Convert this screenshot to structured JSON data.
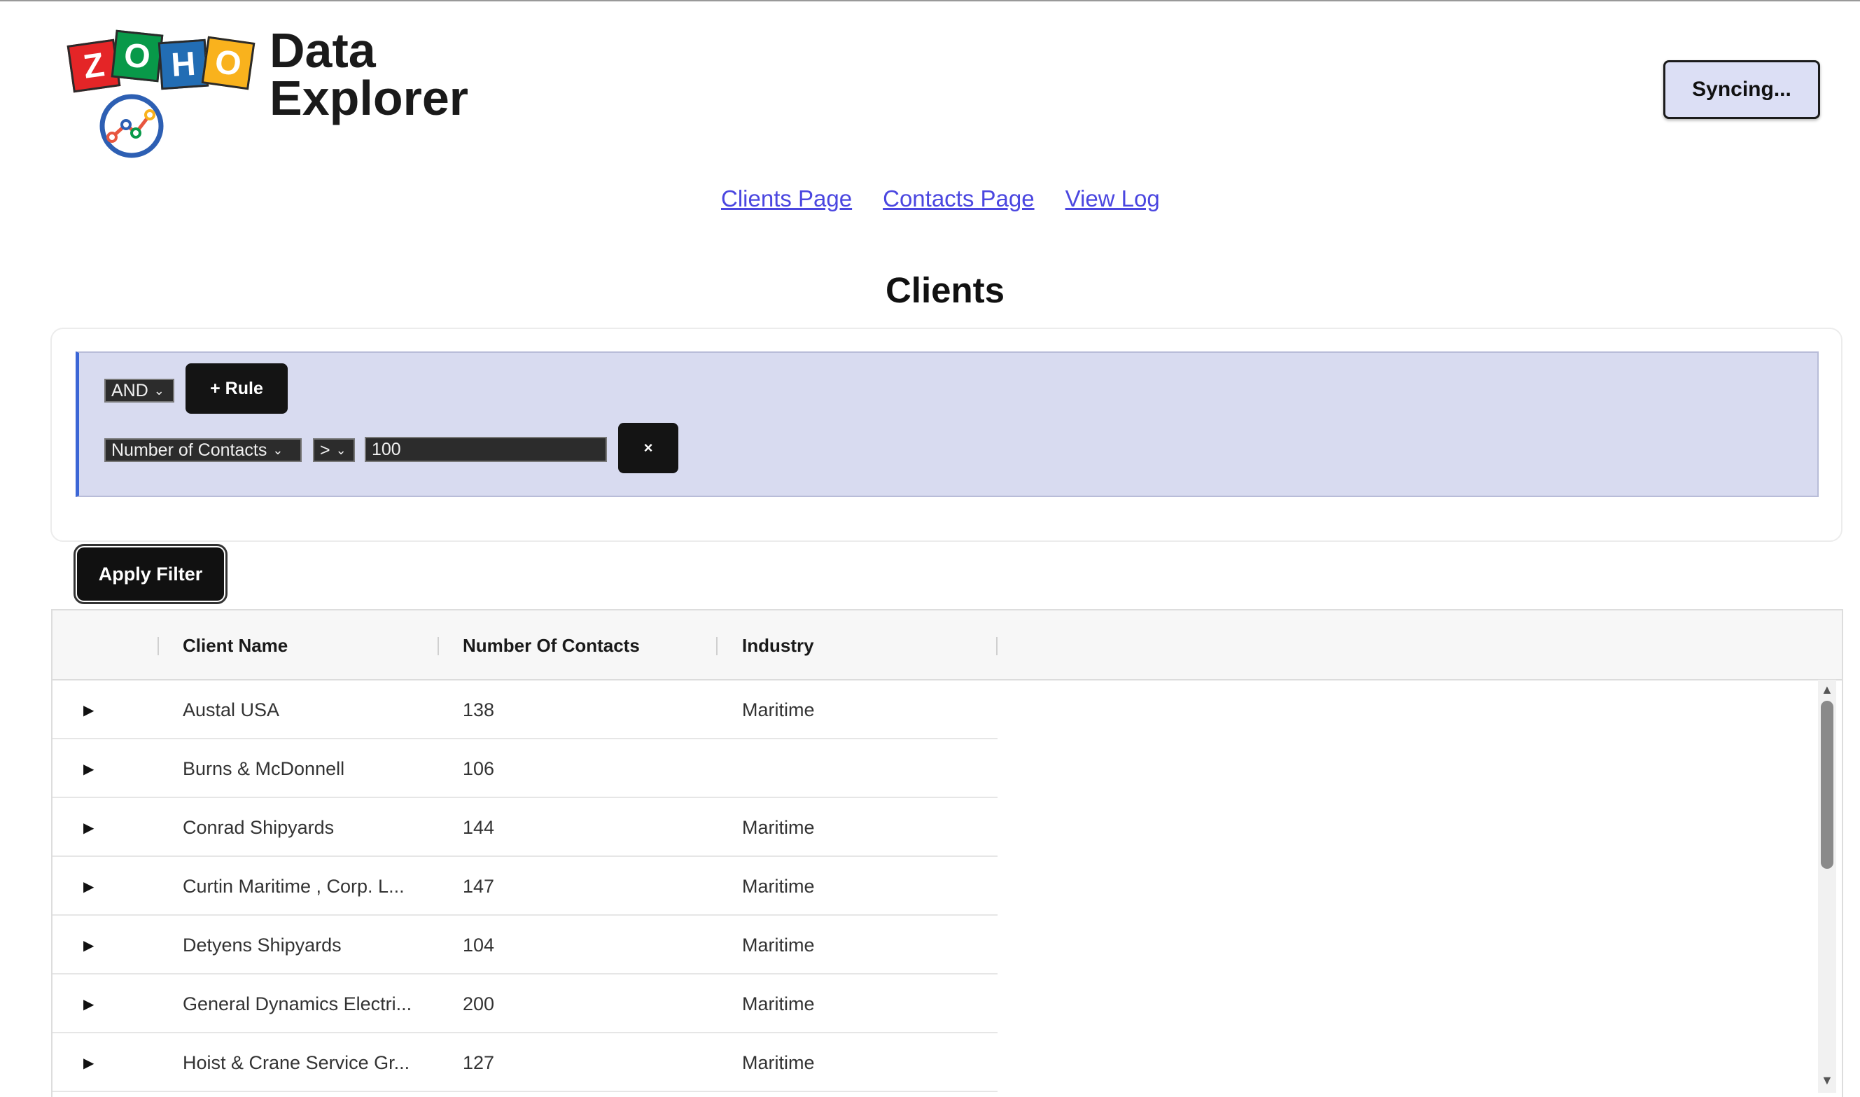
{
  "header": {
    "logo_tiles": [
      "Z",
      "O",
      "H",
      "O"
    ],
    "app_name_line1": "Data",
    "app_name_line2": "Explorer",
    "sync_button": "Syncing..."
  },
  "nav": {
    "links": [
      "Clients Page",
      "Contacts Page",
      "View Log"
    ]
  },
  "page_title": "Clients",
  "filter": {
    "combinator": "AND",
    "add_rule_label": "+ Rule",
    "rule": {
      "field": "Number of Contacts",
      "operator": ">",
      "value": "100",
      "remove_label": "×"
    },
    "apply_label": "Apply Filter"
  },
  "table": {
    "columns": [
      "Client Name",
      "Number Of Contacts",
      "Industry"
    ],
    "rows": [
      {
        "name": "Austal USA",
        "contacts": "138",
        "industry": "Maritime"
      },
      {
        "name": "Burns & McDonnell",
        "contacts": "106",
        "industry": ""
      },
      {
        "name": "Conrad Shipyards",
        "contacts": "144",
        "industry": "Maritime"
      },
      {
        "name": "Curtin Maritime , Corp. L...",
        "contacts": "147",
        "industry": "Maritime"
      },
      {
        "name": "Detyens Shipyards",
        "contacts": "104",
        "industry": "Maritime"
      },
      {
        "name": "General Dynamics Electri...",
        "contacts": "200",
        "industry": "Maritime"
      },
      {
        "name": "Hoist & Crane Service Gr...",
        "contacts": "127",
        "industry": "Maritime"
      }
    ]
  },
  "colors": {
    "link": "#4b47e0",
    "filter_bg": "#d8dbf0",
    "sync_bg": "#dcdff5",
    "accent_border": "#3b66d6"
  }
}
